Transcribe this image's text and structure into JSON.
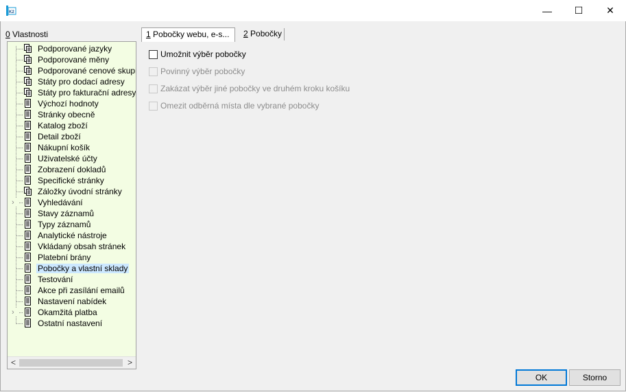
{
  "window": {
    "app_icon": "k2-app-icon",
    "minimize_glyph": "—",
    "maximize_glyph": "☐",
    "close_glyph": "✕"
  },
  "tree": {
    "title_hotkey": "0",
    "title_text": " Vlastnosti",
    "items": [
      {
        "label": "Podporované jazyky",
        "icon": "multi-doc-icon"
      },
      {
        "label": "Podporované měny",
        "icon": "multi-doc-icon"
      },
      {
        "label": "Podporované cenové skupiny",
        "icon": "multi-doc-icon"
      },
      {
        "label": "Státy pro dodací adresy",
        "icon": "multi-doc-icon"
      },
      {
        "label": "Státy pro fakturační adresy",
        "icon": "multi-doc-icon"
      },
      {
        "label": "Výchozí hodnoty",
        "icon": "doc-icon"
      },
      {
        "label": "Stránky obecně",
        "icon": "doc-icon"
      },
      {
        "label": "Katalog zboží",
        "icon": "doc-icon"
      },
      {
        "label": "Detail zboží",
        "icon": "doc-icon"
      },
      {
        "label": "Nákupní košík",
        "icon": "doc-icon"
      },
      {
        "label": "Uživatelské účty",
        "icon": "doc-icon"
      },
      {
        "label": "Zobrazení dokladů",
        "icon": "doc-icon"
      },
      {
        "label": "Specifické stránky",
        "icon": "doc-icon"
      },
      {
        "label": "Záložky úvodní stránky",
        "icon": "multi-doc-icon"
      },
      {
        "label": "Vyhledávání",
        "icon": "doc-icon",
        "expandable": true
      },
      {
        "label": "Stavy záznamů",
        "icon": "doc-icon"
      },
      {
        "label": "Typy záznamů",
        "icon": "doc-icon"
      },
      {
        "label": "Analytické nástroje",
        "icon": "doc-icon"
      },
      {
        "label": "Vkládaný obsah stránek",
        "icon": "doc-icon"
      },
      {
        "label": "Platební brány",
        "icon": "doc-icon"
      },
      {
        "label": "Pobočky a vlastní sklady",
        "icon": "doc-icon",
        "selected": true
      },
      {
        "label": "Testování",
        "icon": "doc-icon"
      },
      {
        "label": "Akce při zasílání emailů",
        "icon": "doc-icon"
      },
      {
        "label": "Nastavení nabídek",
        "icon": "doc-icon"
      },
      {
        "label": "Okamžitá platba",
        "icon": "doc-icon",
        "expandable": true
      },
      {
        "label": "Ostatní nastavení",
        "icon": "doc-icon"
      }
    ],
    "scroll_left": "<",
    "scroll_right": ">",
    "background_color": "#f3fde3",
    "selected_color": "#cce8ff"
  },
  "tabs": [
    {
      "hotkey": "1",
      "label": " Pobočky webu, e-s..."
    },
    {
      "hotkey": "2",
      "label": " Pobočky"
    }
  ],
  "options": [
    {
      "label": "Umožnit výběr pobočky",
      "enabled": true,
      "checked": false
    },
    {
      "label": "Povinný výběr pobočky",
      "enabled": false,
      "checked": false
    },
    {
      "label": "Zakázat výběr jiné pobočky ve druhém kroku košíku",
      "enabled": false,
      "checked": false
    },
    {
      "label": "Omezit odběrná místa dle vybrané pobočky",
      "enabled": false,
      "checked": false
    }
  ],
  "buttons": {
    "ok": "OK",
    "cancel": "Storno"
  }
}
